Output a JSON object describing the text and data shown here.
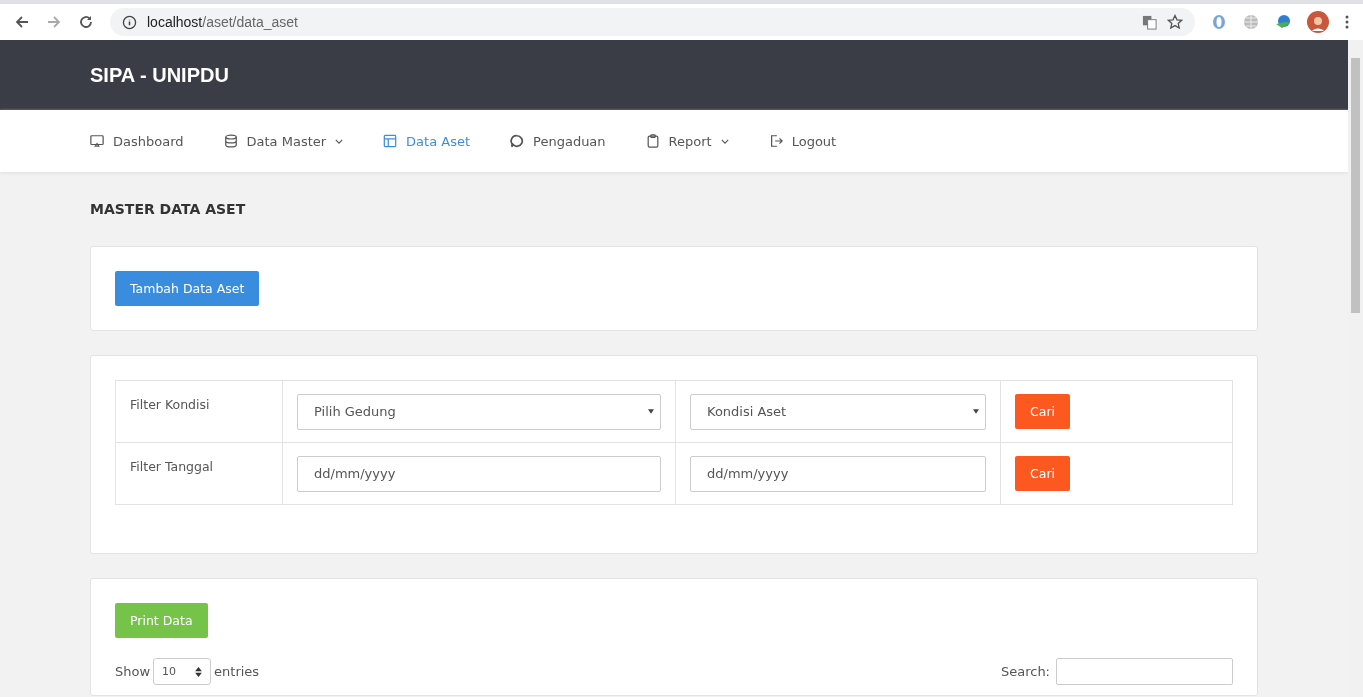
{
  "browser": {
    "url_host": "localhost",
    "url_path": "/aset/data_aset"
  },
  "brand": "SIPA - UNIPDU",
  "nav": [
    {
      "label": "Dashboard",
      "kind": "monitor",
      "selected": false,
      "dropdown": false
    },
    {
      "label": "Data Master",
      "kind": "database",
      "selected": false,
      "dropdown": true
    },
    {
      "label": "Data Aset",
      "kind": "table",
      "selected": true,
      "dropdown": false
    },
    {
      "label": "Pengaduan",
      "kind": "chat",
      "selected": false,
      "dropdown": false
    },
    {
      "label": "Report",
      "kind": "clipboard",
      "selected": false,
      "dropdown": true
    },
    {
      "label": "Logout",
      "kind": "logout",
      "selected": false,
      "dropdown": false
    }
  ],
  "page_title": "MASTER DATA ASET",
  "add_button": "Tambah Data Aset",
  "filters": [
    {
      "label": "Filter Kondisi",
      "kind": "select",
      "fields": [
        {
          "value": "Pilih Gedung"
        },
        {
          "value": "Kondisi Aset"
        }
      ],
      "button": "Cari"
    },
    {
      "label": "Filter Tanggal",
      "kind": "date",
      "fields": [
        {
          "placeholder": "dd/mm/yyyy"
        },
        {
          "placeholder": "dd/mm/yyyy"
        }
      ],
      "button": "Cari"
    }
  ],
  "print_button": "Print Data",
  "length": {
    "before": "Show",
    "value": "10",
    "after": "entries"
  },
  "search_label": "Search:"
}
